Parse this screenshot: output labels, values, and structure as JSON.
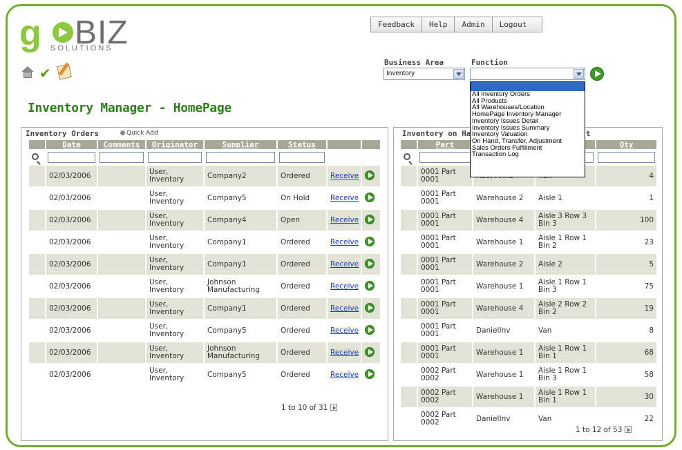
{
  "logo": {
    "letter_g": "g",
    "biz": "BIZ",
    "solutions": "SOLUTIONS"
  },
  "topnav": [
    "Feedback",
    "Help",
    "Admin",
    "Logout"
  ],
  "business_area": {
    "label": "Business Area",
    "value": "Inventory"
  },
  "function": {
    "label": "Function",
    "value": "",
    "options": [
      "All Inventory Orders",
      "All Products",
      "All Warehouses/Location",
      "HomePage Inventory Manager",
      "Inventory Issues Detail",
      "Inventory Issues Summary",
      "Inventory Valuation",
      "On Hand, Transfer, Adjustment",
      "Sales Orders Fulfillment",
      "Transaction Log"
    ]
  },
  "page_title": "Inventory Manager - HomePage",
  "orders": {
    "title": "Inventory Orders",
    "quick_add": "Quick Add",
    "columns": [
      "Date",
      "Comments",
      "Originator",
      "Supplier",
      "Status"
    ],
    "action_label": "Receive",
    "rows": [
      {
        "date": "02/03/2006",
        "comments": "",
        "originator": "User, Inventory",
        "supplier": "Company2",
        "status": "Ordered"
      },
      {
        "date": "02/03/2006",
        "comments": "",
        "originator": "User, Inventory",
        "supplier": "Company5",
        "status": "On Hold"
      },
      {
        "date": "02/03/2006",
        "comments": "",
        "originator": "User, Inventory",
        "supplier": "Company4",
        "status": "Open"
      },
      {
        "date": "02/03/2006",
        "comments": "",
        "originator": "User, Inventory",
        "supplier": "Company1",
        "status": "Ordered"
      },
      {
        "date": "02/03/2006",
        "comments": "",
        "originator": "User, Inventory",
        "supplier": "Company1",
        "status": "Ordered"
      },
      {
        "date": "02/03/2006",
        "comments": "",
        "originator": "User, Inventory",
        "supplier": "Johnson Manufacturing",
        "status": "Ordered"
      },
      {
        "date": "02/03/2006",
        "comments": "",
        "originator": "User, Inventory",
        "supplier": "Company1",
        "status": "Ordered"
      },
      {
        "date": "02/03/2006",
        "comments": "",
        "originator": "User, Inventory",
        "supplier": "Company5",
        "status": "Ordered"
      },
      {
        "date": "02/03/2006",
        "comments": "",
        "originator": "User, Inventory",
        "supplier": "Johnson Manufacturing",
        "status": "Ordered"
      },
      {
        "date": "02/03/2006",
        "comments": "",
        "originator": "User, Inventory",
        "supplier": "Company5",
        "status": "Ordered"
      }
    ],
    "pager": "1 to 10 of 31"
  },
  "onhand": {
    "title": "Inventory on Ha",
    "title_tail": "t",
    "columns": [
      "Part",
      "",
      "",
      "Qty"
    ],
    "rows": [
      {
        "part": "0001 Part 0001",
        "warehouse": "Abb, Anna",
        "location": "Van",
        "qty": "4"
      },
      {
        "part": "0001 Part 0001",
        "warehouse": "Warehouse 2",
        "location": "Aisle 1",
        "qty": "1"
      },
      {
        "part": "0001 Part 0001",
        "warehouse": "Warehouse 4",
        "location": "Aisle 3 Row 3 Bin 3",
        "qty": "100"
      },
      {
        "part": "0001 Part 0001",
        "warehouse": "Warehouse 1",
        "location": "Aisle 1 Row 1 Bin 2",
        "qty": "23"
      },
      {
        "part": "0001 Part 0001",
        "warehouse": "Warehouse 2",
        "location": "Aisle 2",
        "qty": "5"
      },
      {
        "part": "0001 Part 0001",
        "warehouse": "Warehouse 1",
        "location": "Aisle 1 Row 1 Bin 3",
        "qty": "75"
      },
      {
        "part": "0001 Part 0001",
        "warehouse": "Warehouse 4",
        "location": "Aisle 2 Row 2 Bin 2",
        "qty": "19"
      },
      {
        "part": "0001 Part 0001",
        "warehouse": "DanielInv",
        "location": "Van",
        "qty": "8"
      },
      {
        "part": "0001 Part 0001",
        "warehouse": "Warehouse 1",
        "location": "Aisle 1 Row 1 Bin 1",
        "qty": "68"
      },
      {
        "part": "0002 Part 0002",
        "warehouse": "Warehouse 1",
        "location": "Aisle 1 Row 1 Bin 3",
        "qty": "58"
      },
      {
        "part": "0002 Part 0002",
        "warehouse": "Warehouse 1",
        "location": "Aisle 1 Row 1 Bin 1",
        "qty": "30"
      },
      {
        "part": "0002 Part 0002",
        "warehouse": "DanielInv",
        "location": "Van",
        "qty": "22"
      }
    ],
    "pager": "1 to 12 of 53"
  },
  "colors": {
    "accent_green": "#2f7d1c",
    "frame_green": "#6fae2e",
    "header_gray": "#a8a89a",
    "row_alt": "#e2e2d6",
    "link_blue": "#1a3fb0"
  }
}
